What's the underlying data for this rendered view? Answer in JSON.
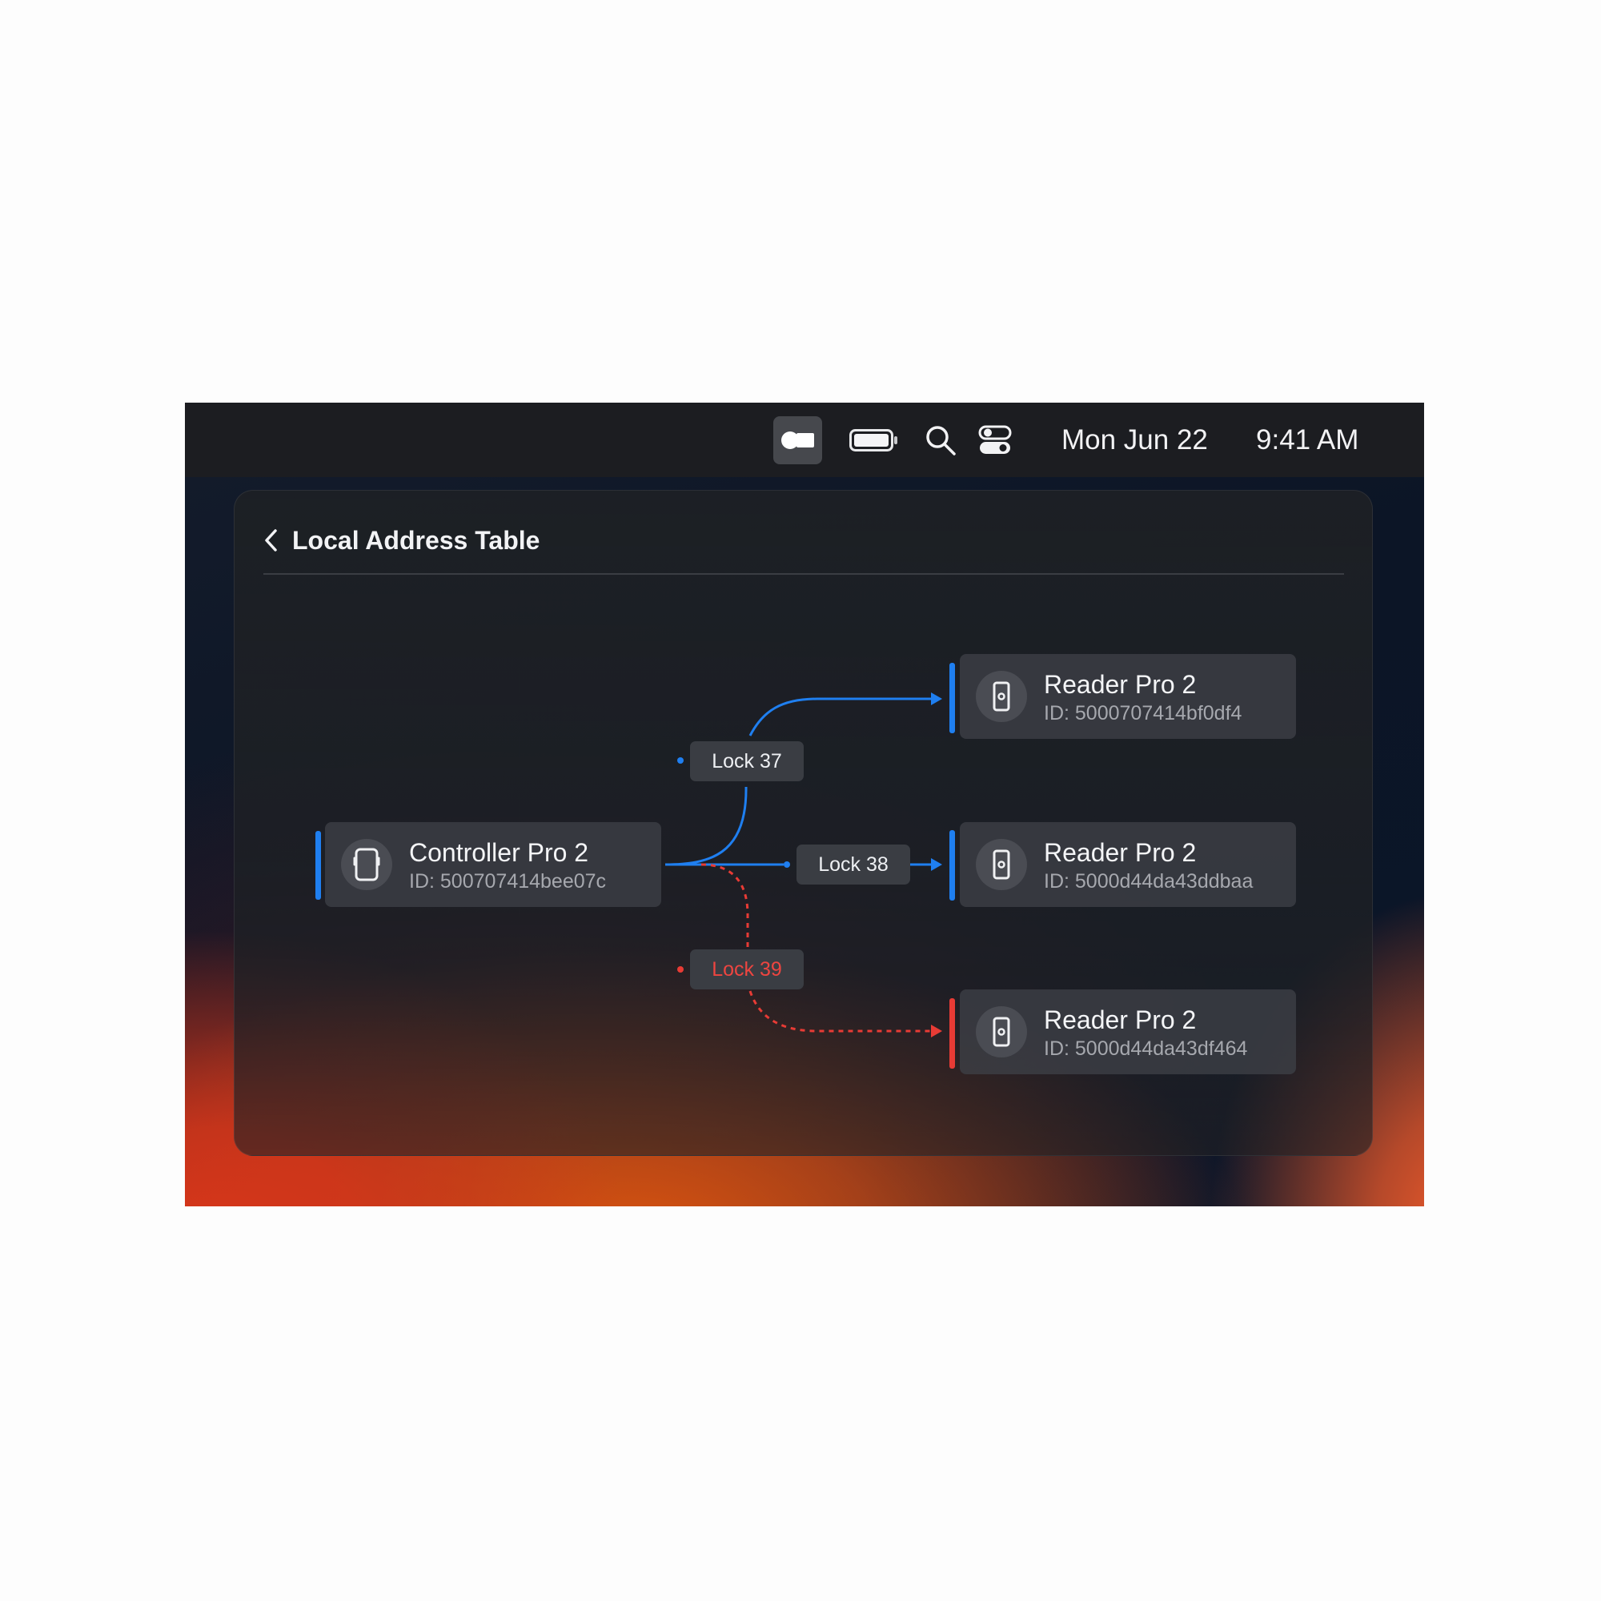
{
  "menubar": {
    "icons": [
      "screen-mirroring-icon",
      "battery-icon",
      "search-icon",
      "control-center-icon"
    ],
    "date": "Mon Jun 22",
    "time": "9:41 AM"
  },
  "page": {
    "title": "Local Address Table"
  },
  "colors": {
    "accent_blue": "#1f7ff0",
    "accent_red": "#e83b35",
    "panel": "#1d2025"
  },
  "controller": {
    "name": "Controller Pro 2",
    "id": "ID: 500707414bee07c",
    "icon": "controller-device-icon"
  },
  "links": [
    {
      "label": "Lock 37",
      "status": "connected"
    },
    {
      "label": "Lock 38",
      "status": "connected"
    },
    {
      "label": "Lock 39",
      "status": "error"
    }
  ],
  "readers": [
    {
      "name": "Reader Pro 2",
      "id": "ID: 5000707414bf0df4",
      "icon": "reader-device-icon"
    },
    {
      "name": "Reader Pro 2",
      "id": "ID: 5000d44da43ddbaa",
      "icon": "reader-device-icon"
    },
    {
      "name": "Reader Pro 2",
      "id": "ID: 5000d44da43df464",
      "icon": "reader-device-icon"
    }
  ]
}
